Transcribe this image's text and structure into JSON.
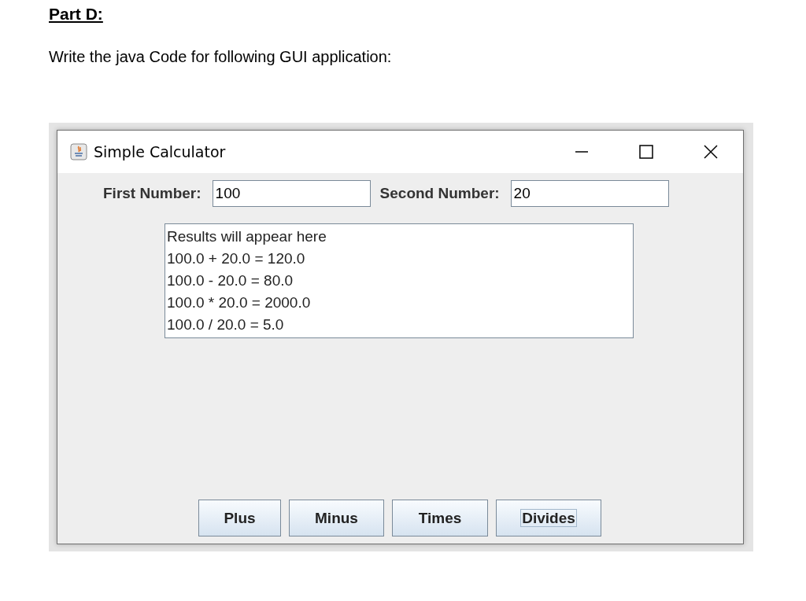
{
  "heading": "Part D:",
  "instruction": "Write the java Code for following GUI application:",
  "window": {
    "title": "Simple Calculator",
    "fields": [
      {
        "label": "First Number:",
        "value": "100"
      },
      {
        "label": "Second Number:",
        "value": "20"
      }
    ],
    "results": [
      "Results will appear here",
      "100.0 + 20.0 = 120.0",
      "100.0 - 20.0 = 80.0",
      "100.0 * 20.0 = 2000.0",
      "100.0 / 20.0 = 5.0"
    ],
    "buttons": [
      {
        "label": "Plus",
        "focused": false
      },
      {
        "label": "Minus",
        "focused": false
      },
      {
        "label": "Times",
        "focused": false
      },
      {
        "label": "Divides",
        "focused": true
      }
    ]
  }
}
